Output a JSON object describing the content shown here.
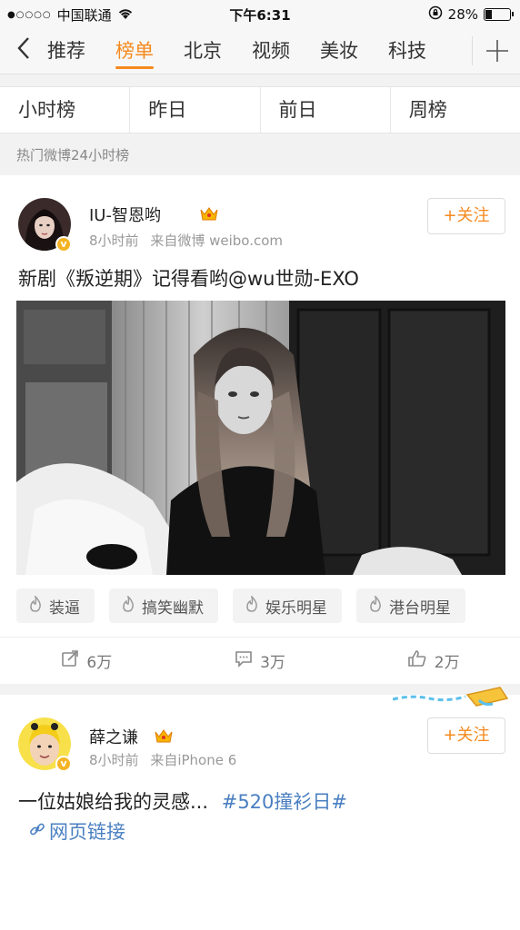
{
  "status_bar": {
    "carrier": "中国联通",
    "time": "下午6:31",
    "battery": "28%",
    "battery_level": 0.28
  },
  "channels": {
    "tabs": [
      "推荐",
      "榜单",
      "北京",
      "视频",
      "美妆",
      "科技"
    ],
    "active_index": 1
  },
  "subtabs": [
    "小时榜",
    "昨日",
    "前日",
    "周榜"
  ],
  "section_label": "热门微博24小时榜",
  "posts": [
    {
      "user": "IU-智恩哟",
      "time": "8小时前",
      "source": "来自微博 weibo.com",
      "follow_label": "+关注",
      "text": "新剧《叛逆期》记得看哟@wu世勋-EXO",
      "tags": [
        "装逼",
        "搞笑幽默",
        "娱乐明星",
        "港台明星"
      ],
      "reposts": "6万",
      "comments": "3万",
      "likes": "2万"
    },
    {
      "user": "薛之谦",
      "time": "8小时前",
      "source": "来自iPhone 6",
      "follow_label": "+关注",
      "text": "一位姑娘给我的灵感...",
      "topic": "#520撞衫日#",
      "link": "网页链接"
    }
  ],
  "colors": {
    "accent": "#f58a1e",
    "link": "#4a7fc1",
    "verified": "#f5b324"
  }
}
